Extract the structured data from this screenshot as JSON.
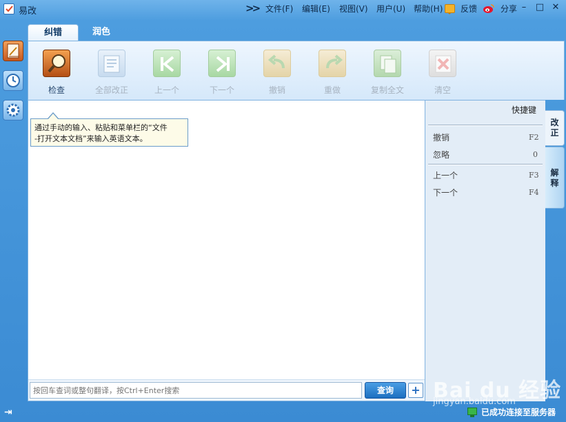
{
  "app": {
    "title": "易改"
  },
  "menu": {
    "chevron": ">>",
    "items": [
      "文件(F)",
      "编辑(E)",
      "视图(V)",
      "用户(U)",
      "帮助(H)"
    ],
    "feedback_label": "反馈",
    "share_label": "分享"
  },
  "window_controls": {
    "minimize": "–",
    "maximize": "□",
    "close": "✕"
  },
  "rail": [
    "edit-icon",
    "history-clock-icon",
    "settings-gear-icon"
  ],
  "tabs": [
    {
      "label": "纠错",
      "active": true
    },
    {
      "label": "润色",
      "active": false
    }
  ],
  "toolbar": {
    "items": [
      {
        "label": "检查",
        "enabled": true,
        "icon": "magnifier-book-icon"
      },
      {
        "label": "全部改正",
        "enabled": false,
        "icon": "correct-all-icon"
      },
      {
        "label": "上一个",
        "enabled": false,
        "icon": "previous-icon"
      },
      {
        "label": "下一个",
        "enabled": false,
        "icon": "next-icon"
      },
      {
        "label": "撤销",
        "enabled": false,
        "icon": "undo-icon"
      },
      {
        "label": "重做",
        "enabled": false,
        "icon": "redo-icon"
      },
      {
        "label": "复制全文",
        "enabled": false,
        "icon": "copy-all-icon"
      },
      {
        "label": "清空",
        "enabled": false,
        "icon": "clear-icon"
      }
    ]
  },
  "editor": {
    "tooltip_line1": "通过手动的输入、粘贴和菜单栏的“文件",
    "tooltip_line2": "-打开文本文档”来输入英语文本。"
  },
  "search": {
    "placeholder": "按回车查词或整句翻译，按Ctrl+Enter搜索",
    "button_label": "查询",
    "plus_label": "+"
  },
  "shortcuts": {
    "title": "快捷键",
    "items": [
      {
        "name": "撤销",
        "key": "F2"
      },
      {
        "name": "忽略",
        "key": "0"
      },
      {
        "name": "上一个",
        "key": "F3"
      },
      {
        "name": "下一个",
        "key": "F4"
      }
    ]
  },
  "side_tabs": [
    {
      "label": "改正",
      "active": false
    },
    {
      "label": "解释",
      "active": true
    }
  ],
  "status": {
    "connection": "已成功连接至服务器"
  },
  "watermark": {
    "logo": "Bai du 经验",
    "url": "jingyan.baidu.com"
  },
  "colors": {
    "frame_blue": "#3b8bd3",
    "accent": "#1c6fc0",
    "disabled_text": "#a7b3c0"
  }
}
